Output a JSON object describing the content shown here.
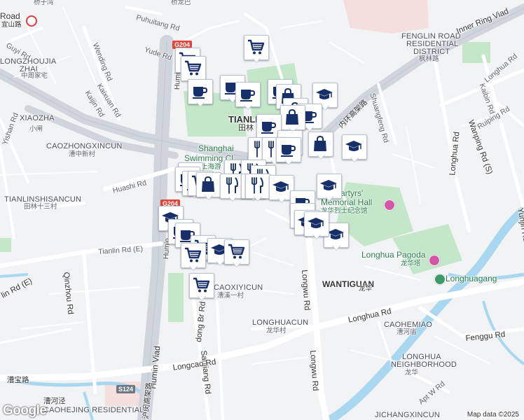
{
  "attribution": {
    "logo": "Google",
    "credit": "Map data ©2025"
  },
  "colors": {
    "water": "#a8d7ef",
    "park": "#c4e6c9",
    "road": "#ffffff",
    "highway": "#d3d8e0",
    "marker_icon": "#18306a"
  },
  "labels": [
    {
      "id": "label-top-zh",
      "text": "桥子湾"
    },
    {
      "id": "label-top-zh2",
      "text": "桥龙巴"
    },
    {
      "id": "label-road",
      "text": "Road"
    },
    {
      "id": "label-yishan-zh",
      "text": "宜山路"
    },
    {
      "id": "label-guyi",
      "text": "Guyi Rd"
    },
    {
      "id": "label-longzhoujia",
      "text": "LONGZHOUJIA"
    },
    {
      "id": "label-zhai",
      "text": "ZHAI"
    },
    {
      "id": "label-zhai-zh",
      "text": "中周家宅"
    },
    {
      "id": "label-puhuitang",
      "text": "Puhuitang Rd"
    },
    {
      "id": "label-yude",
      "text": "Yude Rd"
    },
    {
      "id": "label-wending",
      "text": "Wending Rd"
    },
    {
      "id": "label-kaixuan",
      "text": "Kaixuan Rd"
    },
    {
      "id": "label-kaijin",
      "text": "Kaijin Rd"
    },
    {
      "id": "label-xiaozha",
      "text": "XIAOZHA"
    },
    {
      "id": "label-xiaozha-zh",
      "text": "小闸"
    },
    {
      "id": "label-yishan",
      "text": "Yishan Rd"
    },
    {
      "id": "label-caozhongxincun",
      "text": "CAOZHONGXINCUN"
    },
    {
      "id": "label-caozhong-zh",
      "text": "漕中新村"
    },
    {
      "id": "label-huashi",
      "text": "Huashi Rd"
    },
    {
      "id": "label-tianlinshisancun",
      "text": "TIANLINSHISANCUN"
    },
    {
      "id": "label-tianlin13-zh",
      "text": "田林十三村"
    },
    {
      "id": "label-tianlin-e",
      "text": "Tianlin Rd (E)"
    },
    {
      "id": "label-humin-viad-n",
      "text": "Humin"
    },
    {
      "id": "label-humin-viad-mid",
      "text": "Humin"
    },
    {
      "id": "label-humin-viad",
      "text": "Humin Viad"
    },
    {
      "id": "label-qinzhou",
      "text": "Qinzhou Rd"
    },
    {
      "id": "label-lin-e",
      "text": "lin Rd (E)"
    },
    {
      "id": "label-tianlin",
      "text": "TIANLIN"
    },
    {
      "id": "label-tianlin-zh",
      "text": "田林"
    },
    {
      "id": "label-swim",
      "text": "Shanghai"
    },
    {
      "id": "label-swim2",
      "text": "Swimming Cl"
    },
    {
      "id": "label-swim-zh",
      "text": "上海游"
    },
    {
      "id": "label-caoxi",
      "text": "CAOXIYICUN"
    },
    {
      "id": "label-caoxi-zh",
      "text": "漕溪一村"
    },
    {
      "id": "label-dong-br",
      "text": "dong Br Rd"
    },
    {
      "id": "label-sanjiang",
      "text": "Sanjiang Rd"
    },
    {
      "id": "label-longhuacun",
      "text": "LONGHUACUN"
    },
    {
      "id": "label-longhuacun-zh",
      "text": "龙华村"
    },
    {
      "id": "label-longcao",
      "text": "Longcao Rd"
    },
    {
      "id": "label-caobao-zh",
      "text": "漕宝路"
    },
    {
      "id": "label-caohe-zh",
      "text": "漕河泾"
    },
    {
      "id": "label-caohejing",
      "text": "CAOHEJING RESIDENTIAL"
    },
    {
      "id": "label-fenglin",
      "text": "FENGLIN ROAD"
    },
    {
      "id": "label-fenglin2",
      "text": "RESIDENTIAL"
    },
    {
      "id": "label-fenglin3",
      "text": "DISTRICT"
    },
    {
      "id": "label-fenglin-zh",
      "text": "枫林路"
    },
    {
      "id": "label-inner-ring",
      "text": "Inner Ring Viad"
    },
    {
      "id": "label-inner-zh",
      "text": "内环高架路"
    },
    {
      "id": "label-shuangfeng",
      "text": "Shuangfeng Rd"
    },
    {
      "id": "label-longhua-rd-ne",
      "text": "Longhua Rd"
    },
    {
      "id": "label-kaibin",
      "text": "Kaibin Rd"
    },
    {
      "id": "label-ruiping",
      "text": "Ruiping Rd"
    },
    {
      "id": "label-wanping",
      "text": "Wanping Rd (S)"
    },
    {
      "id": "label-longhua-rd-e",
      "text": "Longhua Rd"
    },
    {
      "id": "label-yunjin",
      "text": "Yunjin Rd"
    },
    {
      "id": "label-martyrs",
      "text": "Martyrs'"
    },
    {
      "id": "label-memorial",
      "text": "Memorial Hall"
    },
    {
      "id": "label-memorial-zh",
      "text": "龙华烈士纪念馆"
    },
    {
      "id": "label-pagoda",
      "text": "Longhua Pagoda"
    },
    {
      "id": "label-pagoda-zh",
      "text": "龙华塔"
    },
    {
      "id": "label-longhuagang",
      "text": "Longhuagang"
    },
    {
      "id": "label-wantiguan",
      "text": "WANTIGUAN"
    },
    {
      "id": "label-wantiguan-zh",
      "text": "龙华"
    },
    {
      "id": "label-longwu-n",
      "text": "Longwu Rd"
    },
    {
      "id": "label-longwu-s",
      "text": "Longwu Rd"
    },
    {
      "id": "label-longhua-s",
      "text": "Longhua Rd"
    },
    {
      "id": "label-caohemiao",
      "text": "CAOHEMIAO"
    },
    {
      "id": "label-caohemiao-zh",
      "text": "漕河庙"
    },
    {
      "id": "label-fenggu",
      "text": "Fenggu Rd"
    },
    {
      "id": "label-lh-neighborhood",
      "text": "LONGHUA"
    },
    {
      "id": "label-lh-neighborhood2",
      "text": "NEIGHBORHOOD"
    },
    {
      "id": "label-lh-neighborhood-zh",
      "text": "龙华"
    },
    {
      "id": "label-apt",
      "text": "Apt W Rd"
    },
    {
      "id": "label-jichang",
      "text": "JICHANGXINCUN"
    },
    {
      "id": "label-humin-zh",
      "text": "沪闵高架路"
    }
  ],
  "shields": [
    {
      "id": "shield-g204-top",
      "text": "G204"
    },
    {
      "id": "shield-g204-mid",
      "text": "G204"
    },
    {
      "id": "shield-s124",
      "text": "S124"
    }
  ],
  "markers": [
    {
      "type": "shopping-cart"
    },
    {
      "type": "shopping-cart"
    },
    {
      "type": "shopping-cart"
    },
    {
      "type": "coffee"
    },
    {
      "type": "coffee"
    },
    {
      "type": "coffee"
    },
    {
      "type": "coffee"
    },
    {
      "type": "shopping-bag"
    },
    {
      "type": "graduation-cap"
    },
    {
      "type": "shopping-bag"
    },
    {
      "type": "coffee"
    },
    {
      "type": "shopping-bag"
    },
    {
      "type": "coffee"
    },
    {
      "type": "coffee"
    },
    {
      "type": "restaurant"
    },
    {
      "type": "restaurant"
    },
    {
      "type": "coffee"
    },
    {
      "type": "shopping-bag"
    },
    {
      "type": "graduation-cap"
    },
    {
      "type": "shopping-cart"
    },
    {
      "type": "coffee"
    },
    {
      "type": "coffee"
    },
    {
      "type": "restaurant"
    },
    {
      "type": "restaurant"
    },
    {
      "type": "restaurant"
    },
    {
      "type": "shopping-cart"
    },
    {
      "type": "shopping-bag"
    },
    {
      "type": "restaurant"
    },
    {
      "type": "restaurant"
    },
    {
      "type": "restaurant"
    },
    {
      "type": "graduation-cap"
    },
    {
      "type": "coffee"
    },
    {
      "type": "graduation-cap"
    },
    {
      "type": "coffee"
    },
    {
      "type": "graduation-cap"
    },
    {
      "type": "graduation-cap"
    },
    {
      "type": "graduation-cap"
    },
    {
      "type": "graduation-cap"
    },
    {
      "type": "coffee"
    },
    {
      "type": "coffee"
    },
    {
      "type": "shopping-cart"
    },
    {
      "type": "graduation-cap"
    },
    {
      "type": "shopping-cart"
    },
    {
      "type": "shopping-cart"
    },
    {
      "type": "shopping-cart"
    }
  ]
}
